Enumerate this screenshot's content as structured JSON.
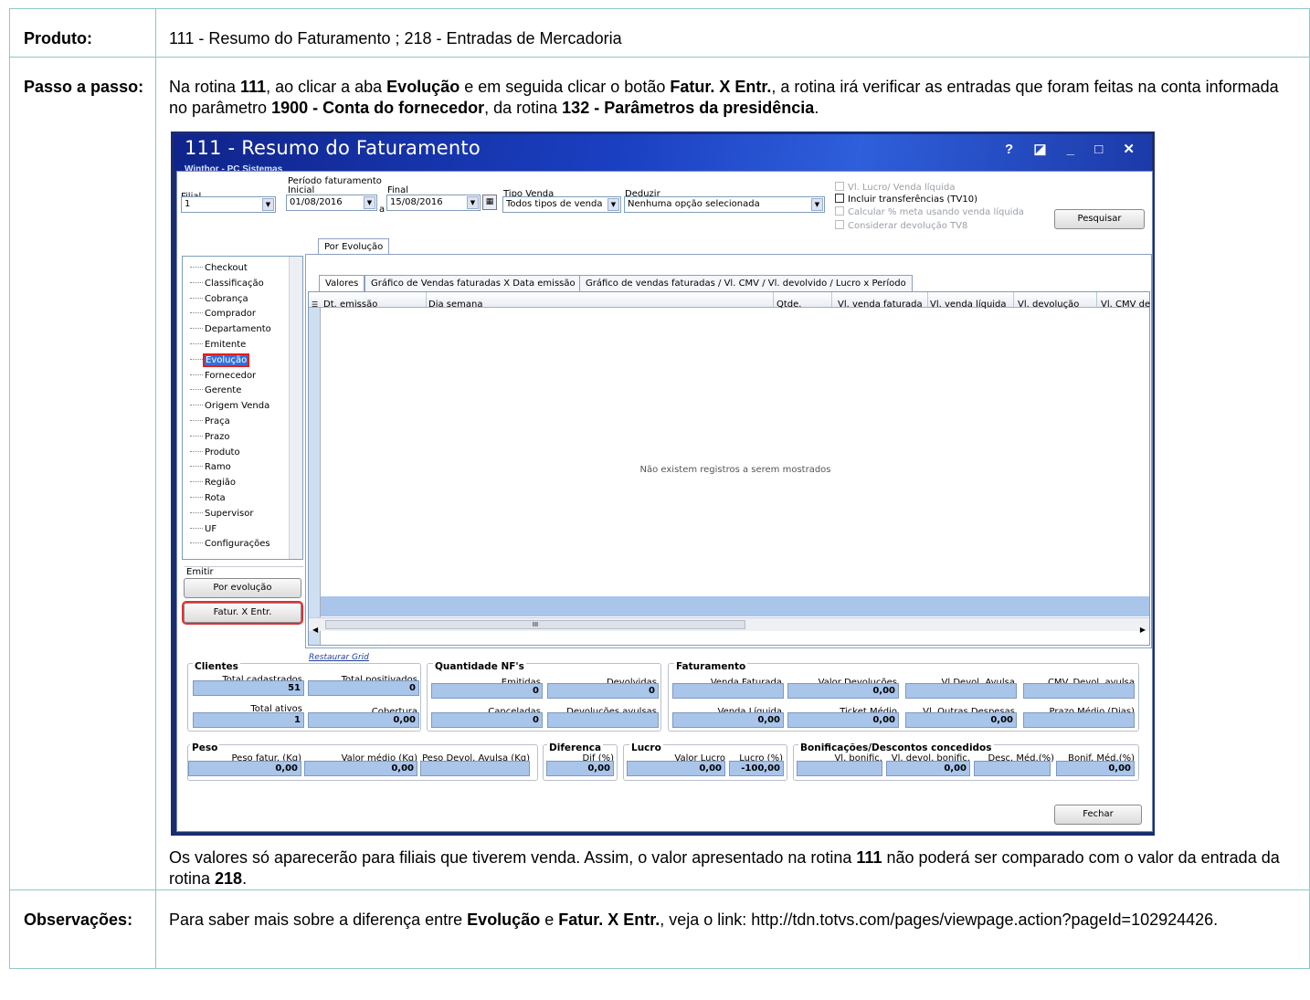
{
  "doc": {
    "produto_label": "Produto:",
    "produto_value": "111 - Resumo do Faturamento ; 218 - Entradas de Mercadoria",
    "passo_label": "Passo a passo:",
    "passo_text": {
      "p1": "Na rotina ",
      "b1": "111",
      "p2": ", ao clicar a aba ",
      "b2": "Evolução",
      "p3": " e em seguida clicar o botão ",
      "b3": "Fatur. X Entr.",
      "p4": ", a rotina irá verificar as entradas que foram feitas na conta informada no parâmetro ",
      "b4": "1900 - Conta do fornecedor",
      "p5": ", da rotina ",
      "b5": "132 - Parâmetros da presidência",
      "p6": "."
    },
    "after_text": {
      "p1": "Os valores só aparecerão para filiais que tiverem venda. Assim, o valor apresentado na rotina ",
      "b1": "111",
      "p2": " não poderá ser comparado com o valor da entrada da rotina ",
      "b2": "218",
      "p3": "."
    },
    "obs_label": "Observações:",
    "obs_text": {
      "p1": "Para saber mais sobre a diferença entre ",
      "b1": "Evolução",
      "p2": " e ",
      "b2": "Fatur. X Entr.",
      "p3": ", veja o link: http://tdn.totvs.com/pages/viewpage.action?pageId=102924426."
    }
  },
  "window": {
    "title": "111 - Resumo do Faturamento",
    "subtitle": "Winthor - PC Sistemas",
    "controls": "? ◪ _ □ ✕",
    "filters": {
      "filial_label": "Filial",
      "filial_value": "1",
      "periodo_label": "Período faturamento",
      "inicial_label": "Inicial",
      "inicial_value": "01/08/2016",
      "a_label": "a",
      "final_label": "Final",
      "final_value": "15/08/2016",
      "tipo_venda_label": "Tipo Venda",
      "tipo_venda_value": "Todos tipos de venda",
      "deduzir_label": "Deduzir",
      "deduzir_value": "Nenhuma opção selecionada"
    },
    "checks": [
      "Vl. Lucro/ Venda líquida",
      "Incluir transferências  (TV10)",
      "Calcular % meta usando venda líquida",
      "Considerar devolução TV8"
    ],
    "pesquisar_button": "Pesquisar",
    "tree_items": [
      "Checkout",
      "Classificação",
      "Cobrança",
      "Comprador",
      "Departamento",
      "Emitente",
      "Evolução",
      "Fornecedor",
      "Gerente",
      "Origem Venda",
      "Praça",
      "Prazo",
      "Produto",
      "Ramo",
      "Região",
      "Rota",
      "Supervisor",
      "UF",
      "Configurações"
    ],
    "emitir_label": "Emitir",
    "por_evolucao_button": "Por evolução",
    "fatur_entr_button": "Fatur. X Entr.",
    "outer_tab": "Por Evolução",
    "inner_tabs": [
      "Valores",
      "Gráfico de Vendas faturadas X Data emissão",
      "Gráfico de vendas faturadas / Vl. CMV / Vl. devolvido / Lucro x Período"
    ],
    "grid_columns": [
      "Dt. emissão",
      "Dia semana",
      "Qtde.",
      "Vl. venda faturada",
      "Vl. venda líquida",
      "Vl. devolução",
      "Vl. CMV de"
    ],
    "grid_empty": "Não existem registros a serem mostrados",
    "scroll_grip": "III",
    "restaurar_grid": "Restaurar Grid",
    "clientes": {
      "title": "Clientes",
      "total_cadastrados_label": "Total cadastrados",
      "total_cadastrados": "51",
      "total_positivados_label": "Total positivados",
      "total_positivados": "0",
      "total_ativos_label": "Total ativos",
      "total_ativos": "1",
      "cobertura_label": "Cobertura",
      "cobertura": "0,00"
    },
    "nfs": {
      "title": "Quantidade NF's",
      "emitidas_label": "Emitidas",
      "emitidas": "0",
      "devolvidas_label": "Devolvidas",
      "devolvidas": "0",
      "canceladas_label": "Canceladas",
      "canceladas": "0",
      "devol_avulsas_label": "Devoluções avulsas",
      "devol_avulsas": ""
    },
    "faturamento": {
      "title": "Faturamento",
      "venda_faturada_label": "Venda Faturada",
      "venda_faturada": "",
      "valor_devolucoes_label": "Valor Devoluções",
      "valor_devolucoes": "0,00",
      "vl_devol_avulsa_label": "Vl.Devol. Avulsa",
      "vl_devol_avulsa": "",
      "cmv_devol_avulsa_label": "CMV. Devol. avulsa",
      "cmv_devol_avulsa": "",
      "venda_liquida_label": "Venda Líquida",
      "venda_liquida": "0,00",
      "ticket_medio_label": "Ticket Médio",
      "ticket_medio": "0,00",
      "vl_outras_despesas_label": "Vl. Outras Despesas",
      "vl_outras_despesas": "0,00",
      "prazo_medio_label": "Prazo Médio (Dias)",
      "prazo_medio": ""
    },
    "peso": {
      "title": "Peso",
      "peso_fatur_label": "Peso fatur. (Kg)",
      "peso_fatur": "0,00",
      "valor_medio_label": "Valor médio (Kg)",
      "valor_medio": "0,00",
      "peso_devol_label": "Peso Devol. Avulsa (Kg)",
      "peso_devol": ""
    },
    "diferenca": {
      "title": "Diferenca",
      "dif_label": "Dif (%)",
      "dif": "0,00"
    },
    "lucro": {
      "title": "Lucro",
      "valor_lucro_label": "Valor Lucro",
      "valor_lucro": "0,00",
      "lucro_pct_label": "Lucro (%)",
      "lucro_pct": "-100,00"
    },
    "bonif": {
      "title": "Bonificações/Descontos concedidos",
      "vl_bonific_label": "Vl. bonific.",
      "vl_bonific": "",
      "vl_devol_bonific_label": "Vl. devol. bonific.",
      "vl_devol_bonific": "0,00",
      "desc_med_label": "Desc. Méd.(%)",
      "desc_med": "",
      "bonif_med_label": "Bonif. Méd.(%)",
      "bonif_med": "0,00"
    },
    "fechar_button": "Fechar"
  }
}
